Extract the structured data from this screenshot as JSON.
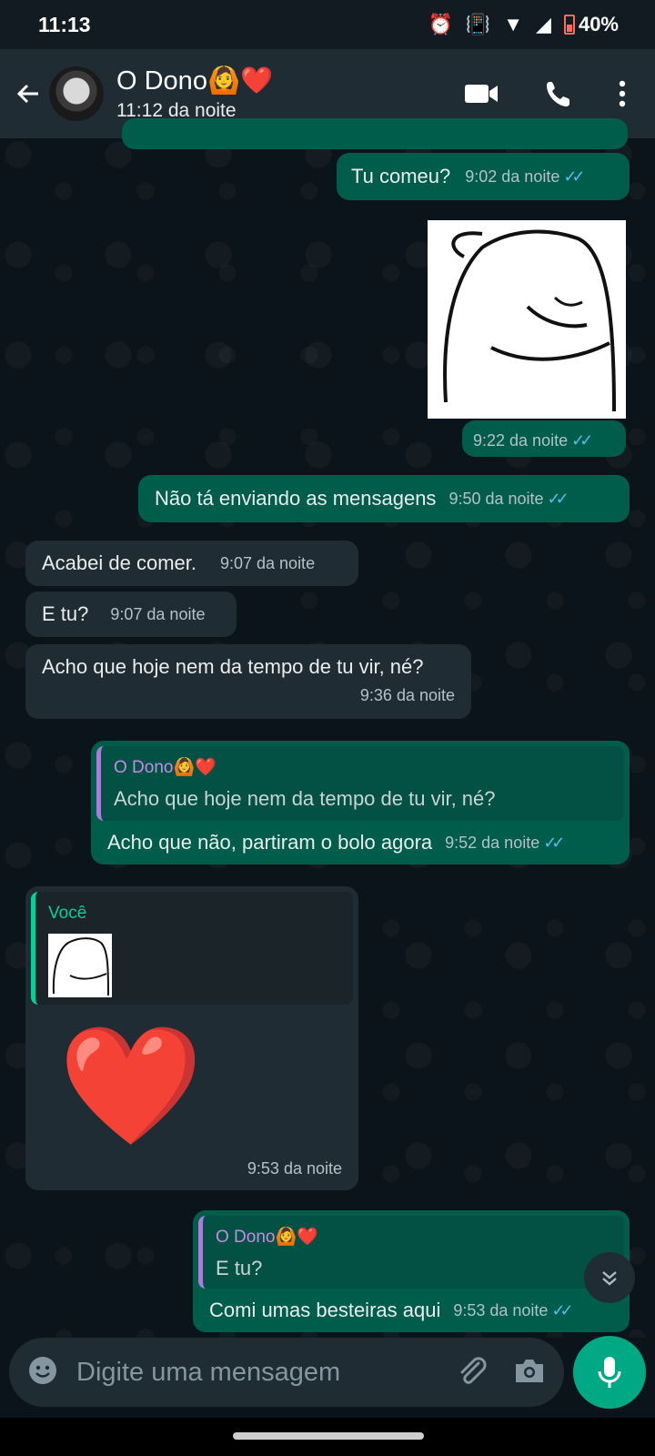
{
  "status_bar": {
    "time": "11:13",
    "battery": "40%"
  },
  "contact": {
    "name": "O Dono🙆❤️",
    "status": "11:12 da noite"
  },
  "messages": [
    {
      "text": "Tu comeu?",
      "time": "9:02 da noite"
    },
    {
      "time": "9:22 da noite"
    },
    {
      "text": "Não tá enviando as mensagens",
      "time": "9:50 da noite"
    },
    {
      "text": "Acabei de comer.",
      "time": "9:07 da noite"
    },
    {
      "text": "E tu?",
      "time": "9:07 da noite"
    },
    {
      "text": "Acho que hoje nem da tempo de tu vir, né?",
      "time": "9:36 da noite"
    },
    {
      "quote_name": "O Dono🙆❤️",
      "quote_text": "Acho que hoje nem da tempo de tu vir, né?",
      "text": "Acho que não, partiram o bolo agora",
      "time": "9:52 da noite"
    },
    {
      "quote_name": "Você",
      "emoji": "❤️",
      "time": "9:53 da noite"
    },
    {
      "quote_name": "O Dono🙆❤️",
      "quote_text": "E tu?",
      "text": "Comi umas besteiras aqui",
      "time": "9:53 da noite"
    }
  ],
  "composer": {
    "placeholder": "Digite uma mensagem"
  },
  "colors": {
    "accent": "#00a884",
    "outgoing": "#005c4b",
    "incoming": "#202c33",
    "read_ticks": "#53bdeb"
  }
}
